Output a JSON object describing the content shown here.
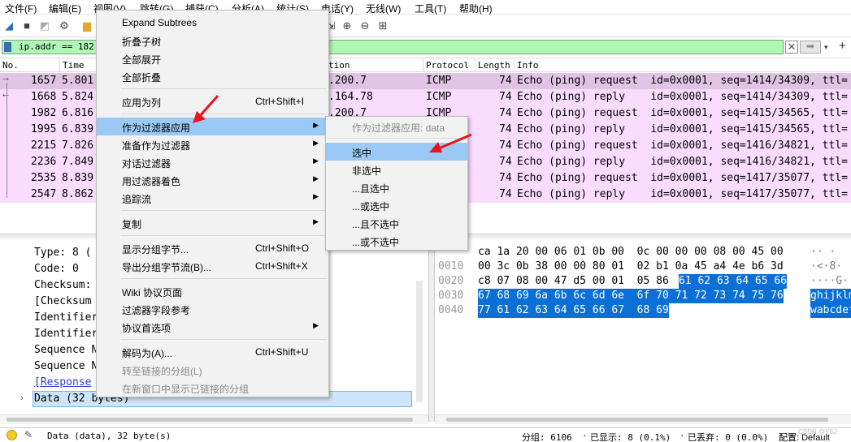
{
  "menubar": [
    "文件(F)",
    "编辑(E)",
    "视图(V)",
    "跳转(G)",
    "捕获(C)",
    "分析(A)",
    "统计(S)",
    "电话(Y)",
    "无线(W)",
    "工具(T)",
    "帮助(H)"
  ],
  "filter": {
    "value": "ip.addr == 182.6"
  },
  "columns": {
    "no": "No.",
    "time": "Time",
    "destination": "tion",
    "protocol": "Protocol",
    "length": "Length",
    "info": "Info"
  },
  "packets": [
    {
      "no": "1657",
      "time": "5.801",
      "dst": ".200.7",
      "proto": "ICMP",
      "len": "74",
      "info": "Echo (ping) request  id=0x0001, seq=1414/34309, ttl="
    },
    {
      "no": "1668",
      "time": "5.824",
      "dst": ".164.78",
      "proto": "ICMP",
      "len": "74",
      "info": "Echo (ping) reply    id=0x0001, seq=1414/34309, ttl="
    },
    {
      "no": "1982",
      "time": "6.816",
      "dst": ".200.7",
      "proto": "ICMP",
      "len": "74",
      "info": "Echo (ping) request  id=0x0001, seq=1415/34565, ttl="
    },
    {
      "no": "1995",
      "time": "6.839",
      "dst": "",
      "proto": "",
      "len": "74",
      "info": "Echo (ping) reply    id=0x0001, seq=1415/34565, ttl="
    },
    {
      "no": "2215",
      "time": "7.826",
      "dst": "",
      "proto": "",
      "len": "74",
      "info": "Echo (ping) request  id=0x0001, seq=1416/34821, ttl="
    },
    {
      "no": "2236",
      "time": "7.849",
      "dst": "",
      "proto": "",
      "len": "74",
      "info": "Echo (ping) reply    id=0x0001, seq=1416/34821, ttl="
    },
    {
      "no": "2535",
      "time": "8.839",
      "dst": "",
      "proto": "",
      "len": "74",
      "info": "Echo (ping) request  id=0x0001, seq=1417/35077, ttl="
    },
    {
      "no": "2547",
      "time": "8.862",
      "dst": "",
      "proto": "",
      "len": "74",
      "info": "Echo (ping) reply    id=0x0001, seq=1417/35077, ttl="
    }
  ],
  "detail": [
    "Type: 8 (",
    "Code: 0",
    "Checksum:",
    "[Checksum",
    "Identifier",
    "Identifier",
    "Sequence N",
    "Sequence N",
    "[Response",
    "Data (32 bytes)"
  ],
  "hex": [
    {
      "off": "",
      "a": "ca 1a 20 00 06 01 0b 00  0c 00 00 00 08 00 45 00",
      "b": "",
      "asc": "·· ·"
    },
    {
      "off": "0010",
      "a": "00 3c 0b 38 00 00 80 01  02 b1 0a 45 a4 4e b6 3d",
      "b": "",
      "asc": "·<·8·"
    },
    {
      "off": "0020",
      "a": "c8 07 08 00 47 d5 00 01  05 86 ",
      "b": "61 62 63 64 65 66",
      "asc": "····G·"
    },
    {
      "off": "0030",
      "a": "",
      "b": "67 68 69 6a 6b 6c 6d 6e  6f 70 71 72 73 74 75 76",
      "asc": "ghijklm"
    },
    {
      "off": "0040",
      "a": "",
      "b": "77 61 62 63 64 65 66 67  68 69",
      "asc": "wabcdef"
    }
  ],
  "context_menu": {
    "items": [
      {
        "label": "Expand Subtrees",
        "sc": "",
        "arrow": false
      },
      {
        "label": "折叠子树",
        "sc": "",
        "arrow": false
      },
      {
        "label": "全部展开",
        "sc": "",
        "arrow": false
      },
      {
        "label": "全部折叠",
        "sc": "",
        "arrow": false
      },
      {
        "label": "应用为列",
        "sc": "Ctrl+Shift+I",
        "arrow": false
      },
      {
        "label": "作为过滤器应用",
        "sc": "",
        "arrow": true
      },
      {
        "label": "准备作为过滤器",
        "sc": "",
        "arrow": true
      },
      {
        "label": "对话过滤器",
        "sc": "",
        "arrow": true
      },
      {
        "label": "用过滤器着色",
        "sc": "",
        "arrow": true
      },
      {
        "label": "追踪流",
        "sc": "",
        "arrow": true
      },
      {
        "label": "复制",
        "sc": "",
        "arrow": true
      },
      {
        "label": "显示分组字节...",
        "sc": "Ctrl+Shift+O",
        "arrow": false
      },
      {
        "label": "导出分组字节流(B)...",
        "sc": "Ctrl+Shift+X",
        "arrow": false
      },
      {
        "label": "Wiki 协议页面",
        "sc": "",
        "arrow": false
      },
      {
        "label": "过滤器字段参考",
        "sc": "",
        "arrow": false
      },
      {
        "label": "协议首选项",
        "sc": "",
        "arrow": true
      },
      {
        "label": "解码为(A)...",
        "sc": "Ctrl+Shift+U",
        "arrow": false
      },
      {
        "label": "转至链接的分组(L)",
        "sc": "",
        "arrow": false
      },
      {
        "label": "在新窗口中显示已链接的分组",
        "sc": "",
        "arrow": false
      }
    ]
  },
  "submenu": {
    "header": "作为过滤器应用: data",
    "items": [
      "选中",
      "非选中",
      "...且选中",
      "...或选中",
      "...且不选中",
      "...或不选中"
    ]
  },
  "status": {
    "text": "Data (data), 32 byte(s)",
    "packets": "分组: 6106",
    "displayed": "已显示: 8 (0.1%)",
    "dropped": "已丢弃: 0 (0.0%)",
    "profile": "配置: Default",
    "watermark": "CSDN @YSJ"
  },
  "colors": {
    "request_row": "#e0c4e4",
    "reply_row": "#f9dcff",
    "filter_bg": "#aff7b5",
    "highlight": "#99c9f4",
    "hex_sel": "#0b6fd6",
    "arrow": "#e8161c"
  }
}
